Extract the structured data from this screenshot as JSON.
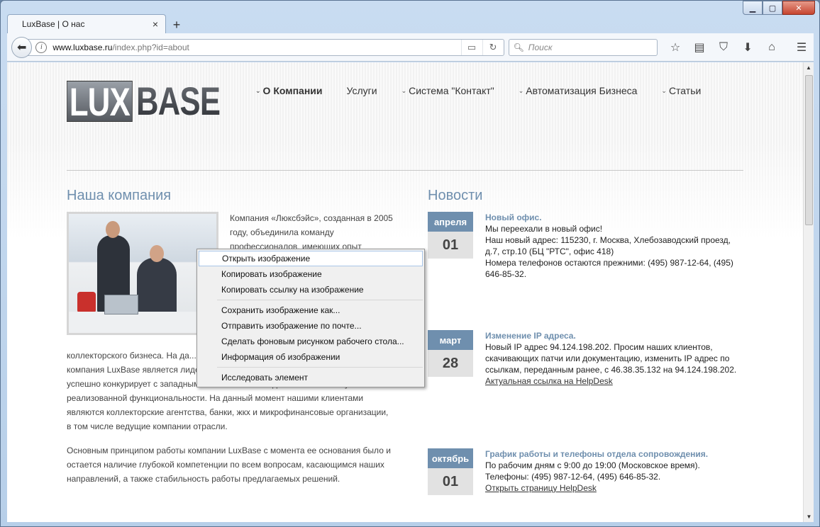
{
  "window": {
    "controls": {
      "minimize": "▁",
      "maximize": "▢",
      "close": "✕"
    }
  },
  "tab": {
    "title": "LuxBase | О нас",
    "close": "×",
    "new_tab": "+"
  },
  "navbar": {
    "url_host": "www.luxbase.ru",
    "url_path": "/index.php?id=about",
    "search_placeholder": "Поиск"
  },
  "site": {
    "logo": {
      "part1": "LUX",
      "part2": "BASE"
    },
    "nav": [
      {
        "label": "О Компании",
        "chevron": true
      },
      {
        "label": "Услуги",
        "chevron": false
      },
      {
        "label": "Система \"Контакт\"",
        "chevron": true
      },
      {
        "label": "Автоматизация Бизнеса",
        "chevron": true
      },
      {
        "label": "Статьи",
        "chevron": true
      }
    ],
    "company_heading": "Наша компания",
    "news_heading": "Новости",
    "intro_top": "Компания «Люксбэйс», созданная в 2005 году, объединила команду профессионалов, имеющих опыт",
    "intro_p1": "коллекторского бизнеса. На да... достигнуть высоких результато... Collection компания LuxBase является лидером продукт «Коллекторская система «Контакт» успешно конкурирует с западными аналогами по надежности и объему реализованной функциональности. На данный момент нашими клиентами являются коллекторские агентства, банки, жкх и микрофинансовые организации, в том числе ведущие компании отрасли.",
    "intro_p2": "Основным принципом работы компании LuxBase с момента ее основания было и остается наличие глубокой компетенции по всем вопросам, касающимся наших направлений, а также стабильность работы предлагаемых решений."
  },
  "news": [
    {
      "month": "апреля",
      "day": "01",
      "title": "Новый офис.",
      "body": "Мы переехали в новый офис!\nНаш новый адрес: 115230, г. Москва, Хлебозаводский проезд, д.7, стр.10 (БЦ \"РТС\", офис 418)\nНомера телефонов остаются прежними: (495) 987-12-64, (495) 646-85-32.",
      "link": ""
    },
    {
      "month": "март",
      "day": "28",
      "title": "Изменение IP адреса.",
      "body": "Новый IP адрес 94.124.198.202. Просим наших клиентов, скачивающих патчи или документацию, изменить IP адрес по ссылкам, переданным ранее, с 46.38.35.132 на 94.124.198.202.",
      "link": "Актуальная ссылка на HelpDesk"
    },
    {
      "month": "октябрь",
      "day": "01",
      "title": "График работы и телефоны отдела сопровождения.",
      "body": "По рабочим дням с 9:00 до 19:00 (Московское время).\nТелефоны: (495) 987-12-64, (495) 646-85-32.",
      "link": "Открыть страницу HelpDesk"
    }
  ],
  "context_menu": [
    "Открыть изображение",
    "Копировать изображение",
    "Копировать ссылку на изображение",
    "Сохранить изображение как...",
    "Отправить изображение по почте...",
    "Сделать фоновым рисунком рабочего стола...",
    "Информация об изображении",
    "Исследовать элемент"
  ],
  "colors": {
    "accent": "#6f8fae",
    "date_bg": "#e2e2e2"
  }
}
